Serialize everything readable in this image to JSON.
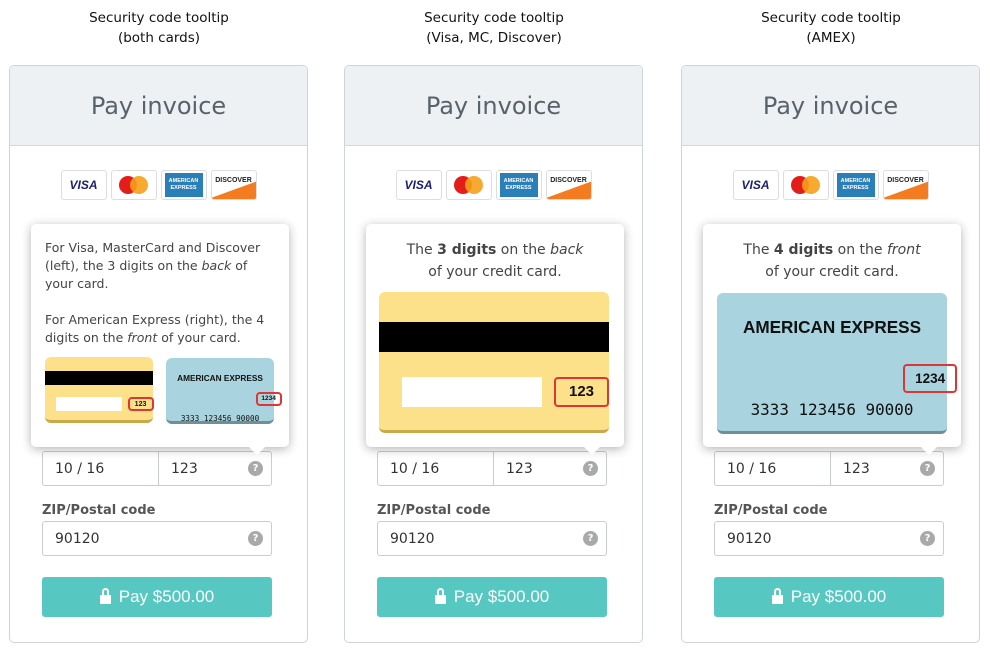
{
  "columns": [
    {
      "title_line1": "Security code tooltip",
      "title_line2": "(both cards)",
      "variant": "both",
      "tooltip": {
        "para1_a": "For Visa, MasterCard and Discover (left), the 3 digits on the ",
        "para1_em": "back",
        "para1_b": " of your card.",
        "para2_a": "For American Express (right), the 4 digits on the ",
        "para2_em": "front",
        "para2_b": " of your card."
      }
    },
    {
      "title_line1": "Security code tooltip",
      "title_line2": "(Visa, MC, Discover)",
      "variant": "back",
      "tooltip": {
        "a": "The ",
        "strong": "3 digits",
        "b": " on the ",
        "em": "back",
        "c": "of your credit card."
      }
    },
    {
      "title_line1": "Security code tooltip",
      "title_line2": "(AMEX)",
      "variant": "front",
      "tooltip": {
        "a": "The ",
        "strong": "4 digits",
        "b": " on the ",
        "em": "front",
        "c": "of your credit card."
      }
    }
  ],
  "panel": {
    "title": "Pay invoice",
    "logos": [
      "VISA",
      "MasterCard",
      "AMERICAN EXPRESS",
      "DISCOVER"
    ],
    "expiry": "10 / 16",
    "cvc": "123",
    "zip_label": "ZIP/Postal code",
    "zip": "90120",
    "pay_label": "Pay $500.00",
    "help": "?"
  },
  "cards": {
    "back_cvv": "123",
    "amex_name": "AMERICAN EXPRESS",
    "amex_cid": "1234",
    "amex_number": "3333 123456 90000"
  },
  "colors": {
    "accent": "#56c8c1",
    "header_bg": "#eef1f4",
    "card_back": "#fde08a",
    "card_amex": "#a8d3df",
    "highlight": "#e03535"
  }
}
